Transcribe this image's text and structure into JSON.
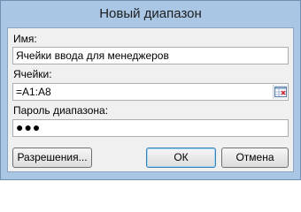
{
  "dialog": {
    "title": "Новый диапазон",
    "name_label": "Имя:",
    "name_value": "Ячейки ввода для менеджеров",
    "cells_label": "Ячейки:",
    "cells_value": "=A1:A8",
    "password_label": "Пароль диапазона:",
    "password_value": "●●●",
    "permissions_button": "Разрешения...",
    "ok_button": "ОК",
    "cancel_button": "Отмена"
  },
  "icons": {
    "range_select": "collapse-dialog-icon"
  },
  "colors": {
    "frame": "#a9c6e4",
    "client": "#f0f0f0",
    "default_button_border": "#3c7fb1"
  }
}
